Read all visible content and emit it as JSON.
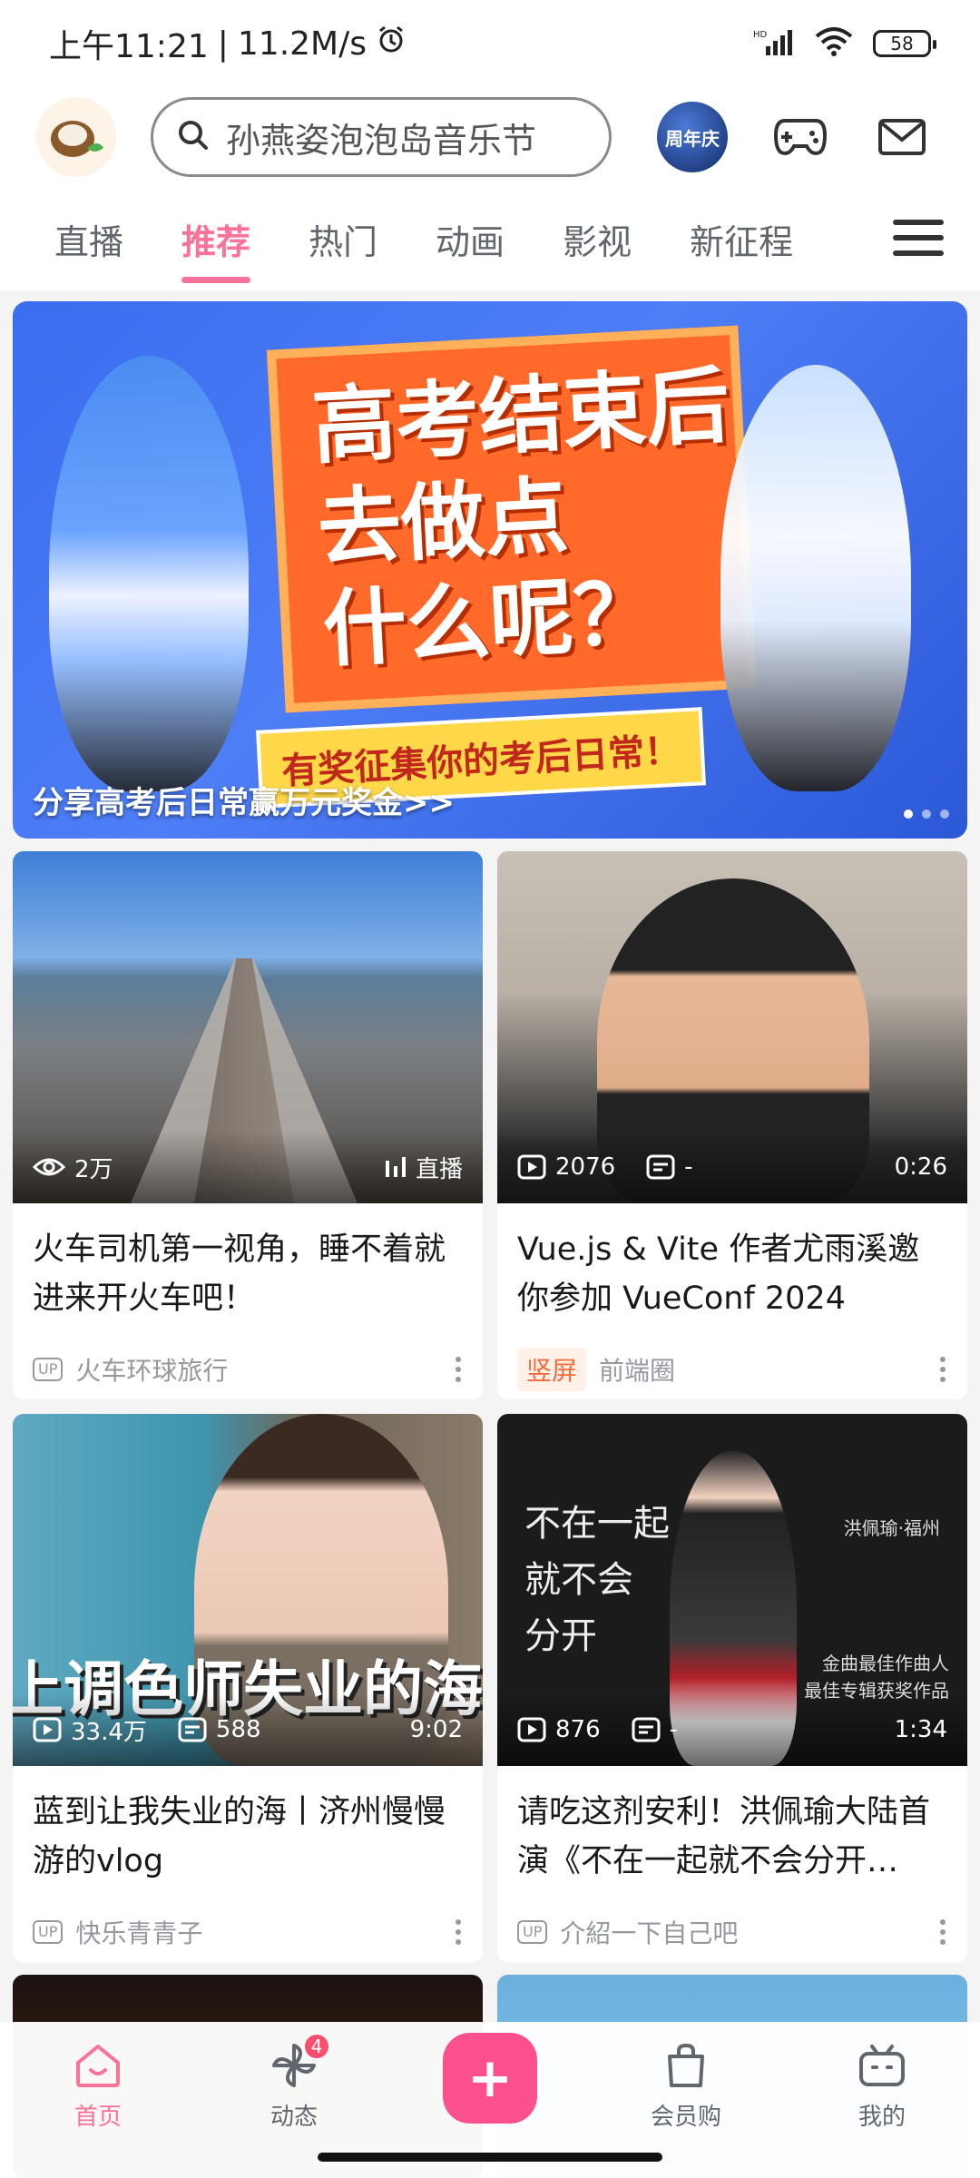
{
  "status": {
    "time": "上午11:21",
    "speed": "11.2M/s",
    "battery": "58",
    "network": "HD"
  },
  "header": {
    "search_placeholder": "孙燕姿泡泡岛音乐节",
    "anniversary_label": "周年庆"
  },
  "tabs": [
    {
      "label": "直播"
    },
    {
      "label": "推荐",
      "active": true
    },
    {
      "label": "热门"
    },
    {
      "label": "动画"
    },
    {
      "label": "影视"
    },
    {
      "label": "新征程"
    }
  ],
  "banner": {
    "headline_1": "高考结束后",
    "headline_2": "去做点",
    "headline_3": "什么呢？",
    "sub": "有奖征集你的考后日常！",
    "caption": "分享高考后日常赢万元奖金>>"
  },
  "cards": [
    {
      "views": "2万",
      "live": "直播",
      "title": "火车司机第一视角，睡不着就进来开火车吧！",
      "up_badge": "UP",
      "uploader": "火车环球旅行"
    },
    {
      "plays": "2076",
      "danmaku": "-",
      "duration": "0:26",
      "title": "Vue.js & Vite 作者尤雨溪邀你参加 VueConf 2024",
      "tag": "竖屏",
      "uploader": "前端圈"
    },
    {
      "plays": "33.4万",
      "danmaku": "588",
      "duration": "9:02",
      "overlay": "上调色师失业的海",
      "title": "蓝到让我失业的海丨济州慢慢游的vlog",
      "up_badge": "UP",
      "uploader": "快乐青青子"
    },
    {
      "plays": "876",
      "danmaku": "-",
      "duration": "1:34",
      "handwriting_1": "不在一起",
      "handwriting_2": "就不会",
      "handwriting_3": "分开",
      "caption_right": "洪佩瑜·福州",
      "caption_award_1": "金曲最佳作曲人",
      "caption_award_2": "最佳专辑获奖作品",
      "title": "请吃这剂安利！洪佩瑜大陆首演《不在一起就不会分开…",
      "up_badge": "UP",
      "uploader": "介紹一下自己吧"
    }
  ],
  "bottom_nav": [
    {
      "label": "首页",
      "active": true
    },
    {
      "label": "动态",
      "badge": "4"
    },
    {
      "label": "+"
    },
    {
      "label": "会员购"
    },
    {
      "label": "我的"
    }
  ],
  "colors": {
    "accent": "#fb7299",
    "publish": "#fb4f8e",
    "tag": "#f36b3a"
  }
}
